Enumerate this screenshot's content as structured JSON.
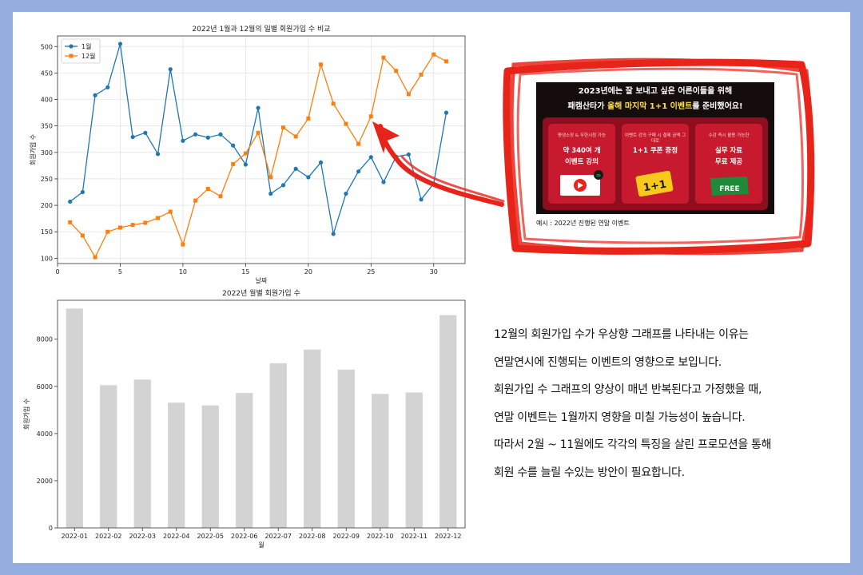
{
  "chart_data": [
    {
      "type": "line",
      "title": "2022년 1월과 12월의 일별 회원가입 수 비교",
      "xlabel": "날짜",
      "ylabel": "회원가입 수",
      "xlim": [
        0,
        32.5
      ],
      "ylim": [
        90,
        520
      ],
      "xticks": [
        0,
        5,
        10,
        15,
        20,
        25,
        30
      ],
      "yticks": [
        100,
        150,
        200,
        250,
        300,
        350,
        400,
        450,
        500
      ],
      "grid": true,
      "legend": "top-left",
      "x": [
        1,
        2,
        3,
        4,
        5,
        6,
        7,
        8,
        9,
        10,
        11,
        12,
        13,
        14,
        15,
        16,
        17,
        18,
        19,
        20,
        21,
        22,
        23,
        24,
        25,
        26,
        27,
        28,
        29,
        30,
        31
      ],
      "series": [
        {
          "name": "1월",
          "color": "#1f77b4",
          "marker": "circle",
          "values": [
            207,
            225,
            408,
            423,
            505,
            329,
            337,
            297,
            457,
            322,
            334,
            328,
            334,
            313,
            277,
            384,
            222,
            238,
            269,
            253,
            281,
            146,
            222,
            264,
            291,
            244,
            292,
            296,
            211,
            241,
            375
          ]
        },
        {
          "name": "12월",
          "color": "#ff7f0e",
          "marker": "square",
          "values": [
            168,
            143,
            102,
            150,
            158,
            163,
            167,
            176,
            188,
            126,
            209,
            231,
            217,
            278,
            298,
            337,
            253,
            347,
            330,
            364,
            466,
            392,
            354,
            316,
            368,
            479,
            454,
            410,
            447,
            485,
            472
          ]
        }
      ]
    },
    {
      "type": "bar",
      "title": "2022년 월별 회원가입 수",
      "xlabel": "월",
      "ylabel": "회원가입 수",
      "ylim": [
        0,
        9650
      ],
      "yticks": [
        0,
        2000,
        4000,
        6000,
        8000
      ],
      "grid": false,
      "bar_color": "#d3d3d3",
      "categories": [
        "2022-01",
        "2022-02",
        "2022-03",
        "2022-04",
        "2022-05",
        "2022-06",
        "2022-07",
        "2022-08",
        "2022-09",
        "2022-10",
        "2022-11",
        "2022-12"
      ],
      "values": [
        9300,
        6050,
        6290,
        5310,
        5190,
        5720,
        6980,
        7560,
        6710,
        5680,
        5740,
        9020
      ]
    }
  ],
  "promo": {
    "headline_1": "2023년에는 잘 보내고 싶은 어른이들을 위해",
    "headline_2_pre": "패캠산타가 ",
    "headline_2_hl": "올해 마지막 1+1 이벤트",
    "headline_2_post": "를 준비했어요!",
    "cards": [
      {
        "sub": "평생소장 & 무한시청 가능",
        "main_1": "약 340여 개",
        "main_2": "이벤트 강의",
        "icon": "play-video-icon"
      },
      {
        "sub": "이벤트 강의 구매 시 결제 금액 그대로",
        "main_1": "1+1 쿠폰 증정",
        "main_2": "",
        "icon": "coupon-icon",
        "coupon_text": "1+1"
      },
      {
        "sub": "수강 즉시 활용 가능한",
        "main_1": "실무 자료",
        "main_2": "무료 제공",
        "icon": "free-gift-icon",
        "badge": "FREE"
      }
    ],
    "caption": "예시 : 2022년 진행된 연말 이벤트",
    "accent": "#e8241a"
  },
  "body_text": [
    "12월의 회원가입 수가 우상향 그래프를 나타내는 이유는",
    "연말연시에 진행되는 이벤트의 영향으로 보입니다.",
    "회원가입 수 그래프의 양상이 매년 반복된다고 가정했을 때,",
    "연말 이벤트는 1월까지 영향을 미칠 가능성이 높습니다.",
    "따라서 2월 ~ 11월에도 각각의 특징을 살린 프로모션을 통해",
    "회원 수를 늘릴 수있는 방안이 필요합니다."
  ]
}
